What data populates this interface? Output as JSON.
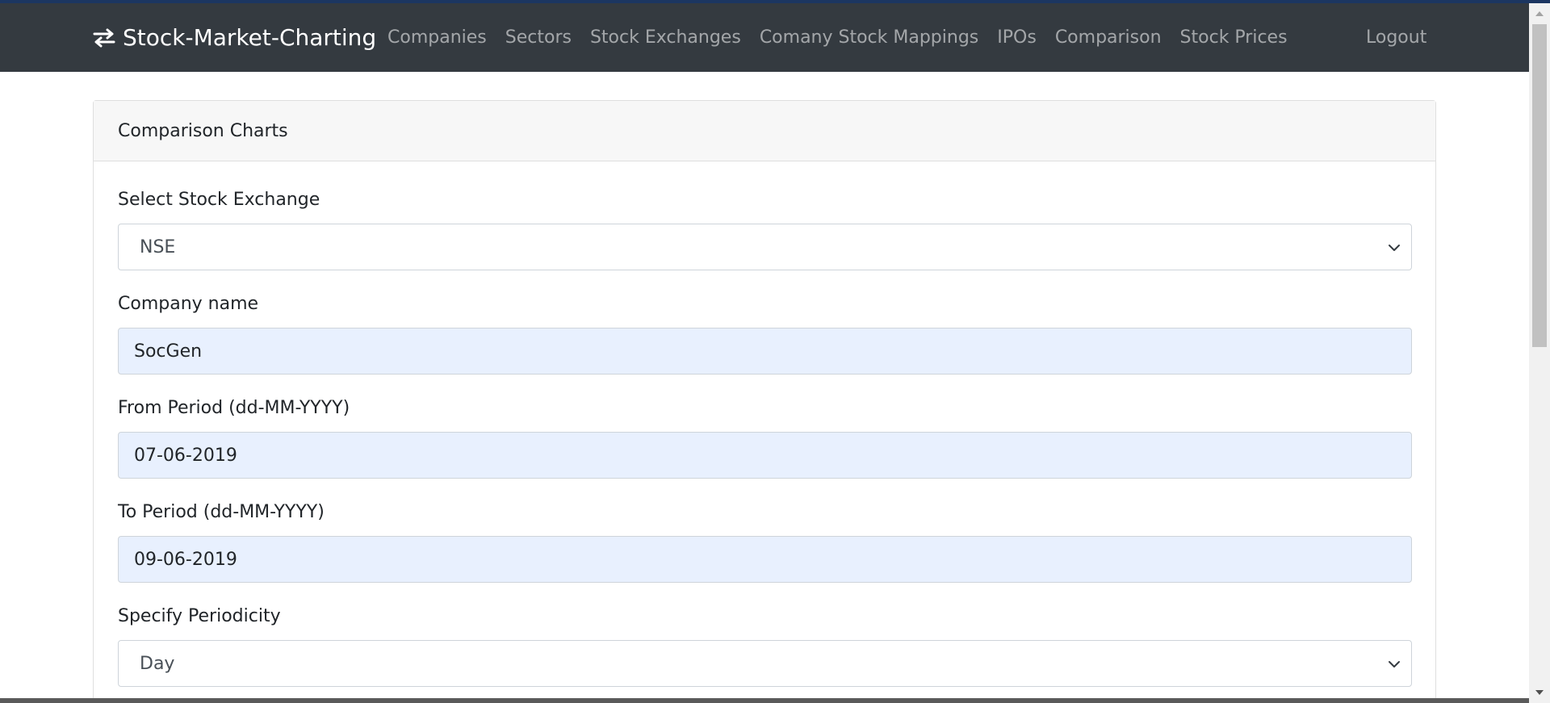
{
  "navbar": {
    "brand": "Stock-Market-Charting",
    "brand_icon": "exchange-arrows-icon",
    "links": [
      "Companies",
      "Sectors",
      "Stock Exchanges",
      "Comany Stock Mappings",
      "IPOs",
      "Comparison",
      "Stock Prices"
    ],
    "logout": "Logout"
  },
  "card": {
    "header": "Comparison Charts"
  },
  "form": {
    "exchange": {
      "label": "Select Stock Exchange",
      "value": "NSE"
    },
    "company": {
      "label": "Company name",
      "value": "SocGen"
    },
    "from_period": {
      "label": "From Period (dd-MM-YYYY)",
      "value": "07-06-2019"
    },
    "to_period": {
      "label": "To Period (dd-MM-YYYY)",
      "value": "09-06-2019"
    },
    "periodicity": {
      "label": "Specify Periodicity",
      "value": "Day"
    }
  },
  "colors": {
    "navbar": "#343a40",
    "autofill": "#e8f0fe",
    "card_header": "#f7f7f7"
  }
}
